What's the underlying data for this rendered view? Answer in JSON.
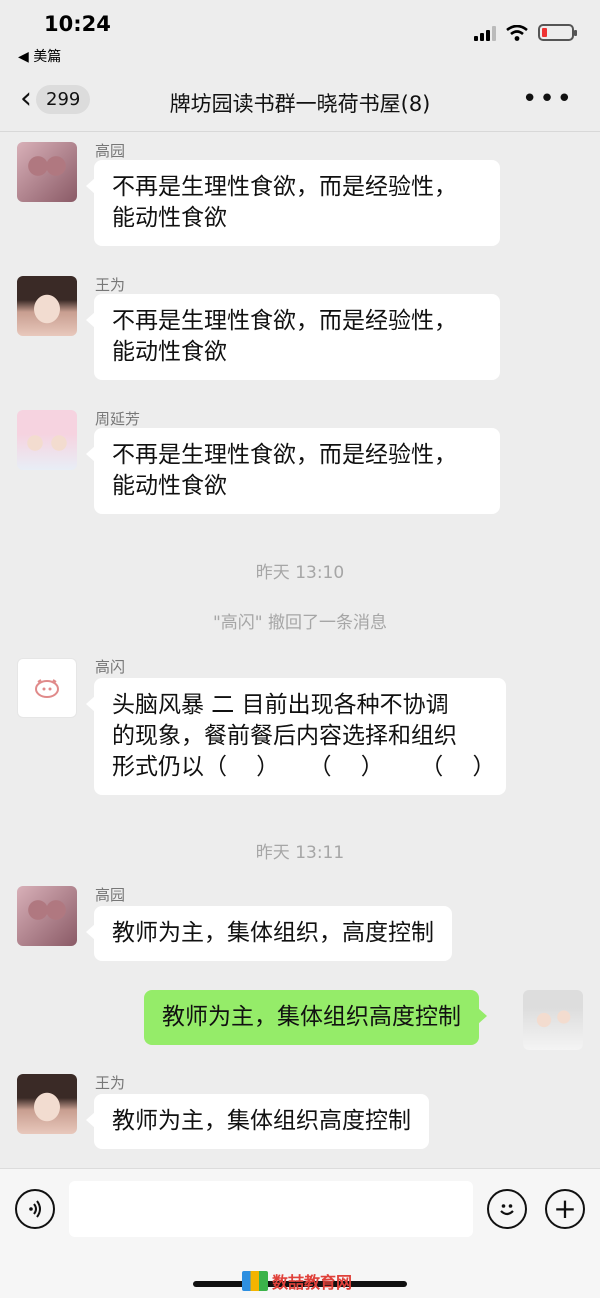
{
  "status": {
    "time": "10:24",
    "back_app": "◀ 美篇"
  },
  "nav": {
    "unread_count": "299",
    "title": "牌坊园读书群一晓荷书屋(8)",
    "more": "•••"
  },
  "messages": [
    {
      "sender": "高园",
      "text_line1": "不再是生理性食欲，而是经验性，",
      "text_line2": "能动性食欲"
    },
    {
      "sender": "王为",
      "text_line1": "不再是生理性食欲，而是经验性，",
      "text_line2": "能动性食欲"
    },
    {
      "sender": "周延芳",
      "text_line1": "不再是生理性食欲，而是经验性，",
      "text_line2": "能动性食欲"
    },
    {
      "sender": "高闪",
      "text_line1": "头脑风暴 二 目前出现各种不协调",
      "text_line2": "的现象，餐前餐后内容选择和组织",
      "text_line3": "形式仍以（    ）    （    ）     （    ）"
    },
    {
      "sender": "高园",
      "text": "教师为主，集体组织，高度控制"
    },
    {
      "sender": "me",
      "text": "教师为主，集体组织高度控制"
    },
    {
      "sender": "王为",
      "text": "教师为主，集体组织高度控制"
    }
  ],
  "system": {
    "time1": "昨天 13:10",
    "recall": "\"高闪\" 撤回了一条消息",
    "time2": "昨天 13:11"
  },
  "input": {
    "placeholder": ""
  },
  "watermark": {
    "text": "数喆教育网"
  }
}
